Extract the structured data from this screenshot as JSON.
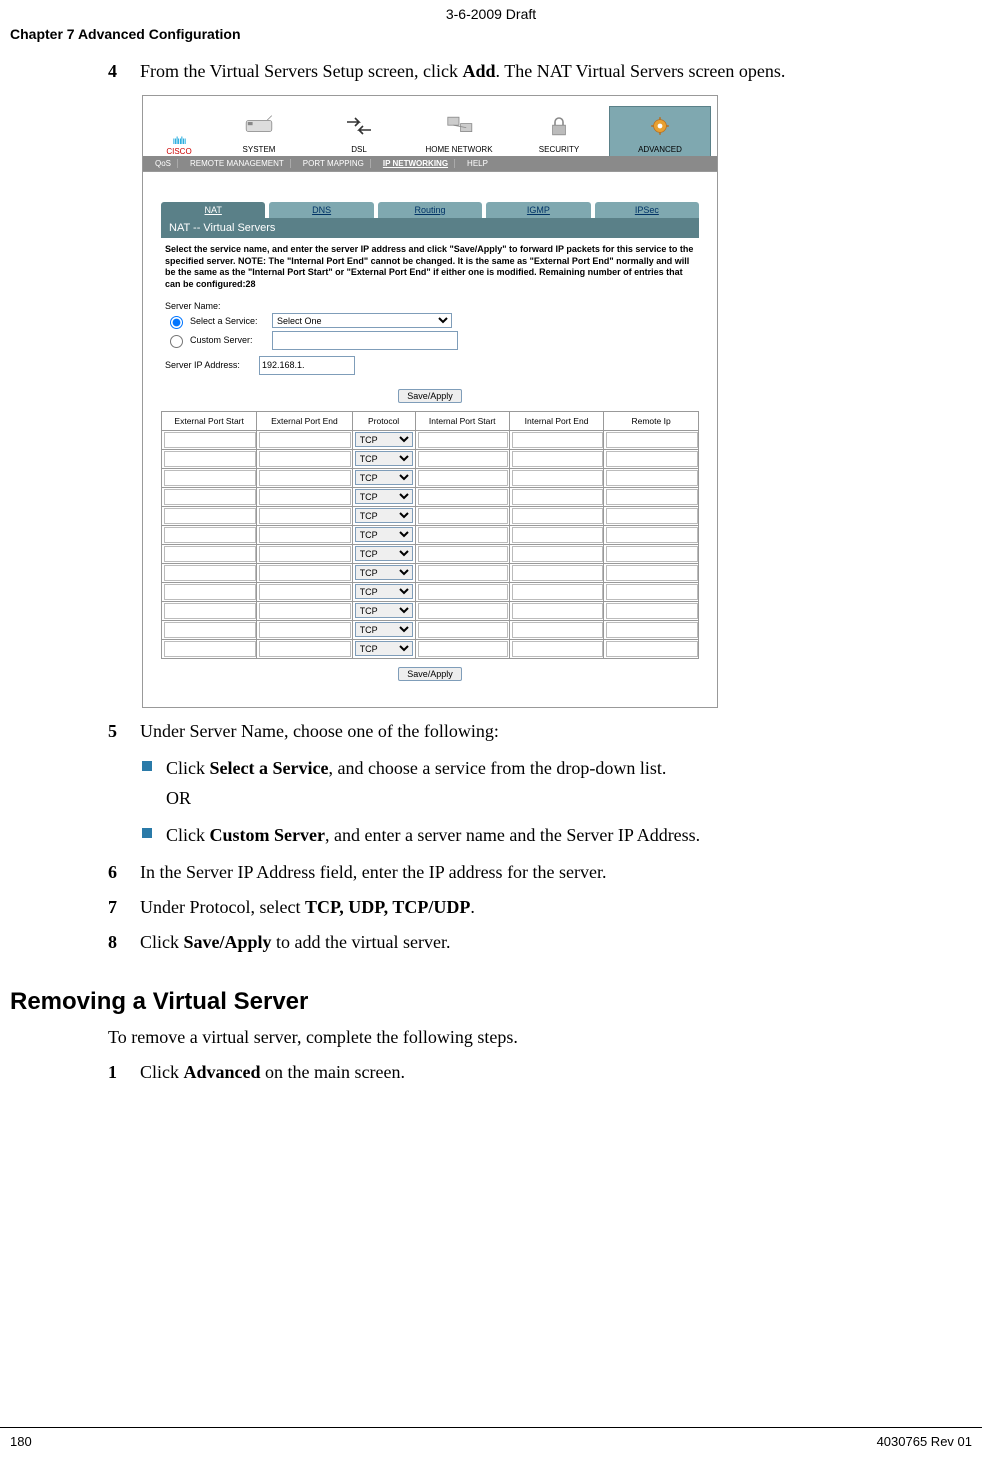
{
  "draft_header": "3-6-2009 Draft",
  "chapter_header": "Chapter 7    Advanced Configuration",
  "steps": {
    "s4": {
      "num": "4",
      "pre": "From the Virtual Servers Setup screen, click ",
      "bold": "Add",
      "post": ". The NAT Virtual Servers screen opens."
    },
    "s5": {
      "num": "5",
      "text": "Under Server Name, choose one of the following:"
    },
    "s6": {
      "num": "6",
      "text": "In the Server IP Address field, enter the IP address for the server."
    },
    "s7": {
      "num": "7",
      "pre": "Under Protocol, select ",
      "bold": "TCP, UDP, TCP/UDP",
      "post": "."
    },
    "s8": {
      "num": "8",
      "pre": "Click ",
      "bold": "Save/Apply",
      "post": " to add the virtual server."
    }
  },
  "bullets": {
    "b1": {
      "pre": "Click ",
      "bold": "Select a Service",
      "post": ", and choose a service from the drop-down list.",
      "or": "OR"
    },
    "b2": {
      "pre": "Click ",
      "bold": "Custom Server",
      "post": ", and enter a server name and the Server IP Address."
    }
  },
  "section": {
    "heading": "Removing a Virtual Server",
    "intro": "To remove a virtual server, complete the following steps.",
    "step1": {
      "num": "1",
      "pre": "Click ",
      "bold": "Advanced",
      "post": " on the main screen."
    }
  },
  "footer": {
    "page": "180",
    "rev": "4030765 Rev 01"
  },
  "screenshot": {
    "logo": {
      "bars": "ıılıılıı",
      "name": "CISCO"
    },
    "topnav": {
      "items": [
        "SYSTEM",
        "DSL",
        "HOME NETWORK",
        "SECURITY",
        "ADVANCED"
      ]
    },
    "subnav": {
      "items": [
        "QoS",
        "REMOTE MANAGEMENT",
        "PORT MAPPING",
        "IP NETWORKING",
        "HELP"
      ]
    },
    "tabs": [
      "NAT",
      "DNS",
      "Routing",
      "IGMP",
      "IPSec"
    ],
    "panel_title": "NAT -- Virtual Servers",
    "instructions": "Select the service name, and enter the server IP address and click \"Save/Apply\" to forward IP packets for this service to the specified server. NOTE: The \"Internal Port End\" cannot be changed. It is the same as \"External Port End\" normally and will be the same as the \"Internal Port Start\" or \"External Port End\" if either one is modified. Remaining number of entries that can be configured:28",
    "server_name_label": "Server Name:",
    "select_service_label": "Select a Service:",
    "select_service_option": "Select One",
    "custom_server_label": "Custom Server:",
    "server_ip_label": "Server IP Address:",
    "server_ip_value": "192.168.1.",
    "save_apply": "Save/Apply",
    "table": {
      "headers": [
        "External Port Start",
        "External Port End",
        "Protocol",
        "Internal Port Start",
        "Internal Port End",
        "Remote Ip"
      ],
      "protocol_option": "TCP",
      "row_count": 12
    }
  }
}
